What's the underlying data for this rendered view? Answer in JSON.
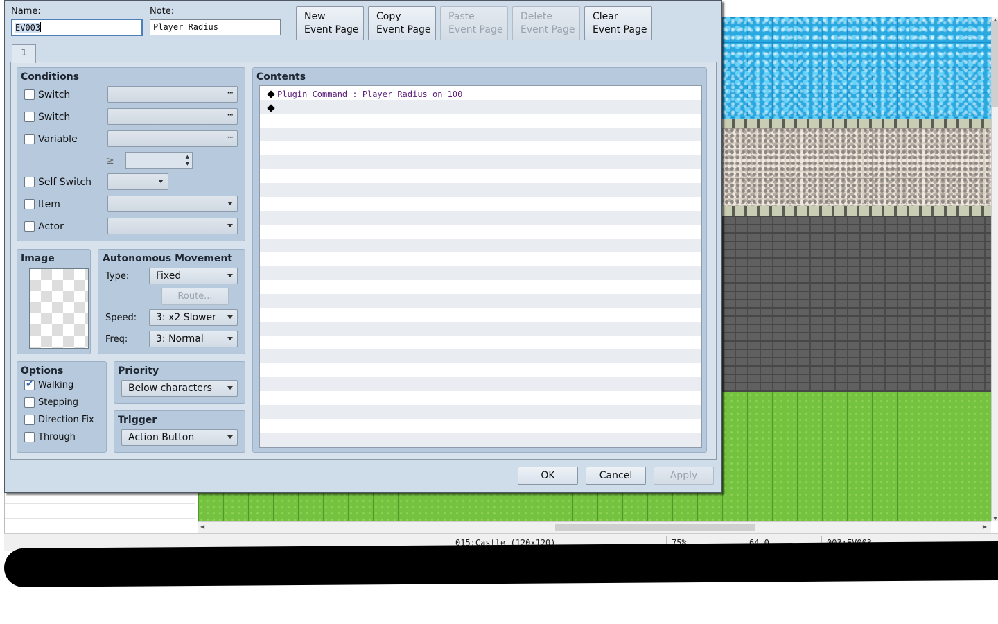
{
  "dialog": {
    "name_label": "Name:",
    "name_value_selected": "EV003",
    "note_label": "Note:",
    "note_value": "Player Radius",
    "buttons": {
      "new_l1": "New",
      "new_l2": "Event Page",
      "copy_l1": "Copy",
      "copy_l2": "Event Page",
      "paste_l1": "Paste",
      "paste_l2": "Event Page",
      "delete_l1": "Delete",
      "delete_l2": "Event Page",
      "clear_l1": "Clear",
      "clear_l2": "Event Page"
    },
    "tab_label": "1",
    "conditions": {
      "title": "Conditions",
      "switch1": "Switch",
      "switch2": "Switch",
      "variable": "Variable",
      "gte": "≥",
      "self_switch": "Self Switch",
      "item": "Item",
      "actor": "Actor",
      "ellipsis": "···"
    },
    "image": {
      "title": "Image"
    },
    "movement": {
      "title": "Autonomous Movement",
      "type_label": "Type:",
      "type_value": "Fixed",
      "route_label": "Route...",
      "speed_label": "Speed:",
      "speed_value": "3: x2 Slower",
      "freq_label": "Freq:",
      "freq_value": "3: Normal"
    },
    "options": {
      "title": "Options",
      "walking": "Walking",
      "walking_checked": true,
      "stepping": "Stepping",
      "direction_fix": "Direction Fix",
      "through": "Through"
    },
    "priority": {
      "title": "Priority",
      "value": "Below characters"
    },
    "trigger": {
      "title": "Trigger",
      "value": "Action Button"
    },
    "contents": {
      "title": "Contents",
      "commands": [
        {
          "command": "Plugin Command",
          "separator": " : ",
          "args": "Player Radius on 100"
        }
      ]
    },
    "ok": "OK",
    "cancel": "Cancel",
    "apply": "Apply"
  },
  "statusbar": {
    "map": "015:Castle (120x120)",
    "zoom": "75%",
    "coords": "64,0",
    "event": "003:EV003"
  },
  "colors": {
    "dialog_bg": "#cfdcea",
    "group_bg": "#b7c9dc",
    "command_text": "#5c1d7a",
    "checkbox_accent": "#2f68b3"
  }
}
